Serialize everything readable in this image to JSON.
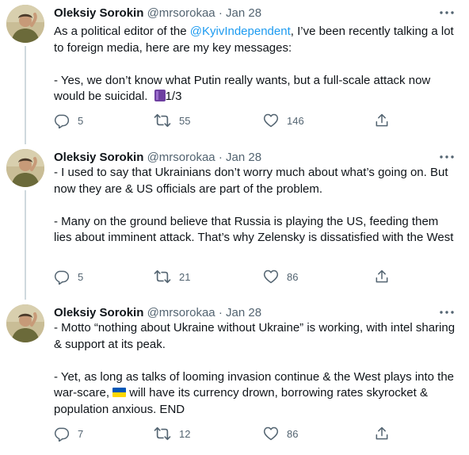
{
  "author": {
    "name": "Oleksiy Sorokin",
    "handle": "@mrsorokaa",
    "separator": "·"
  },
  "tweets": [
    {
      "date": "Jan 28",
      "line1_before": "As a political editor of the ",
      "mention": "@KyivIndependent",
      "line1_after": ", I’ve been recently talking a lot to foreign media, here are my key messages:",
      "paragraph2_text": "- Yes, we don’t know what Putin really wants, but a full-scale attack now would be suicidal.",
      "paragraph2_suffix": "1/3",
      "replies": "5",
      "retweets": "55",
      "likes": "146"
    },
    {
      "date": "Jan 28",
      "paragraph1": "- I used to say that Ukrainians don’t worry much about what’s going on. But now they are & US officials are part of the problem.",
      "paragraph2": "- Many on the ground believe that Russia is playing the US, feeding them lies about imminent attack. That’s why Zelensky is dissatisfied with the West",
      "replies": "5",
      "retweets": "21",
      "likes": "86"
    },
    {
      "date": "Jan 28",
      "paragraph1": "- Motto “nothing about Ukraine without Ukraine” is working, with intel sharing & support at its peak.",
      "paragraph2_before": "- Yet, as long as talks of looming invasion continue & the West plays into the war-scare, ",
      "paragraph2_after": "will have its currency drown, borrowing rates skyrocket & population anxious. END",
      "replies": "7",
      "retweets": "12",
      "likes": "86"
    }
  ],
  "icons": {
    "reply": "reply-icon",
    "retweet": "retweet-icon",
    "like": "heart-icon",
    "share": "share-icon",
    "more": "more-icon",
    "emoji_book": "purple-book-emoji",
    "flag": "ukraine-flag-emoji"
  },
  "colors": {
    "text": "#0f1419",
    "secondary": "#536471",
    "link": "#1d9bf0",
    "connector": "#cfd9de",
    "flag_blue": "#0057b7",
    "flag_yellow": "#ffd700"
  }
}
